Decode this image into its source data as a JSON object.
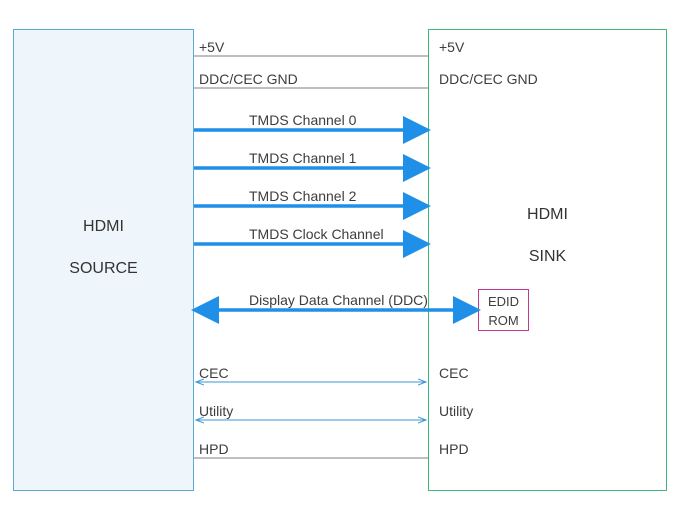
{
  "source": {
    "title1": "HDMI",
    "title2": "SOURCE"
  },
  "sink": {
    "title1": "HDMI",
    "title2": "SINK"
  },
  "edid": {
    "line1": "EDID",
    "line2": "ROM"
  },
  "signals": {
    "p5v_left": "+5V",
    "p5v_right": "+5V",
    "gnd_left": "DDC/CEC GND",
    "gnd_right": "DDC/CEC GND",
    "tmds0": "TMDS Channel 0",
    "tmds1": "TMDS Channel 1",
    "tmds2": "TMDS Channel 2",
    "tmds_clk": "TMDS Clock Channel",
    "ddc": "Display Data Channel (DDC)",
    "cec_left": "CEC",
    "cec_right": "CEC",
    "util_left": "Utility",
    "util_right": "Utility",
    "hpd_left": "HPD",
    "hpd_right": "HPD"
  }
}
